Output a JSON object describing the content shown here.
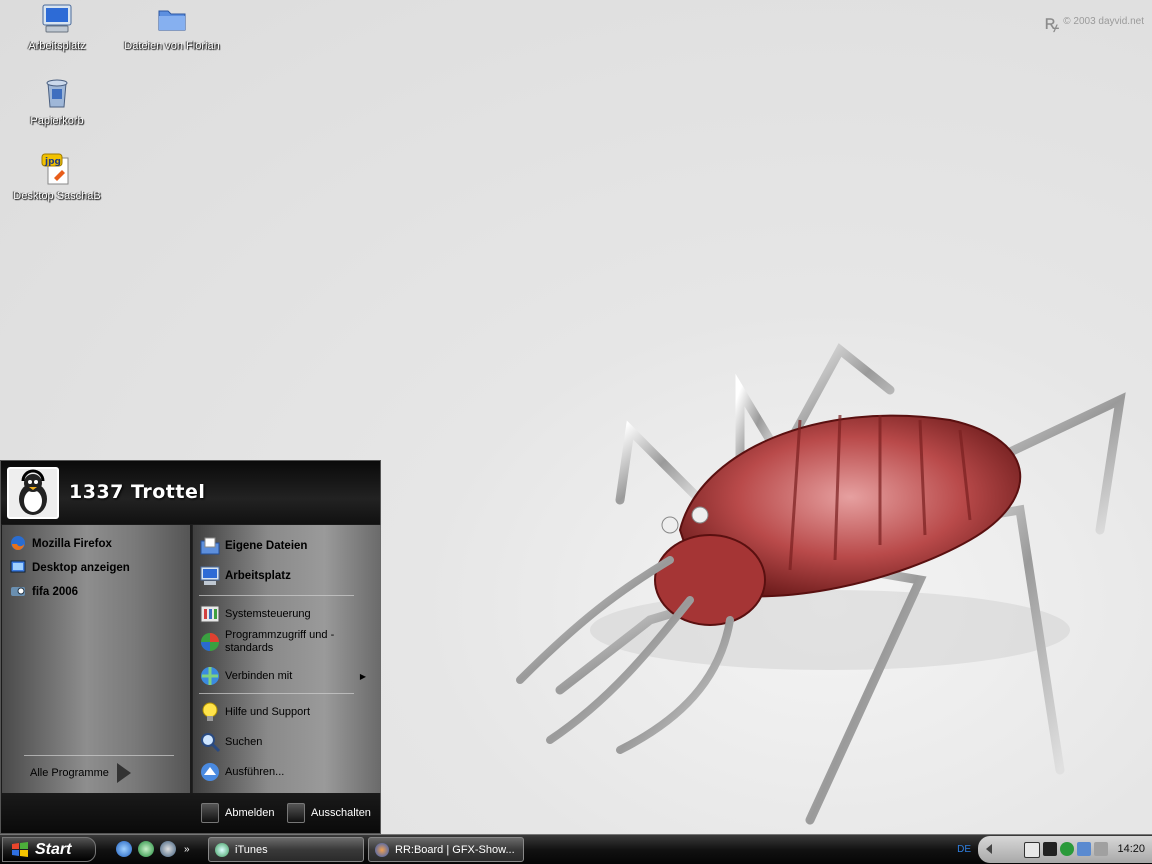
{
  "watermark": "© 2003 dayvid.net",
  "desktop_icons": [
    {
      "label": "Arbeitsplatz",
      "icon": "computer-icon"
    },
    {
      "label": "Dateien von Florian",
      "icon": "folder-icon"
    },
    {
      "label": "Papierkorb",
      "icon": "recycle-bin-icon"
    },
    {
      "label": "Desktop SaschaB",
      "icon": "jpg-file-icon"
    }
  ],
  "start_menu": {
    "username": "1337 Trottel",
    "pinned": [
      {
        "label": "Mozilla Firefox",
        "icon": "firefox-icon"
      },
      {
        "label": "Desktop anzeigen",
        "icon": "show-desktop-icon"
      },
      {
        "label": "fifa 2006",
        "icon": "game-icon"
      }
    ],
    "all_programs": "Alle Programme",
    "places": [
      {
        "label": "Eigene Dateien",
        "icon": "documents-folder-icon"
      },
      {
        "label": "Arbeitsplatz",
        "icon": "computer-icon"
      },
      {
        "label": "Systemsteuerung",
        "icon": "control-panel-icon"
      },
      {
        "label": "Programmzugriff und -standards",
        "icon": "program-defaults-icon"
      },
      {
        "label": "Verbinden mit",
        "icon": "network-connect-icon"
      },
      {
        "label": "Hilfe und Support",
        "icon": "help-bulb-icon"
      },
      {
        "label": "Suchen",
        "icon": "search-icon"
      },
      {
        "label": "Ausführen...",
        "icon": "run-icon"
      }
    ],
    "logoff": "Abmelden",
    "shutdown": "Ausschalten"
  },
  "taskbar": {
    "start_label": "Start",
    "quicklaunch": [
      "ie-icon",
      "media-icon",
      "messenger-icon"
    ],
    "tasks": [
      {
        "label": "iTunes",
        "icon": "itunes-icon"
      },
      {
        "label": "RR:Board | GFX-Show...",
        "icon": "firefox-icon"
      }
    ],
    "language": "DE",
    "clock": "14:20"
  }
}
